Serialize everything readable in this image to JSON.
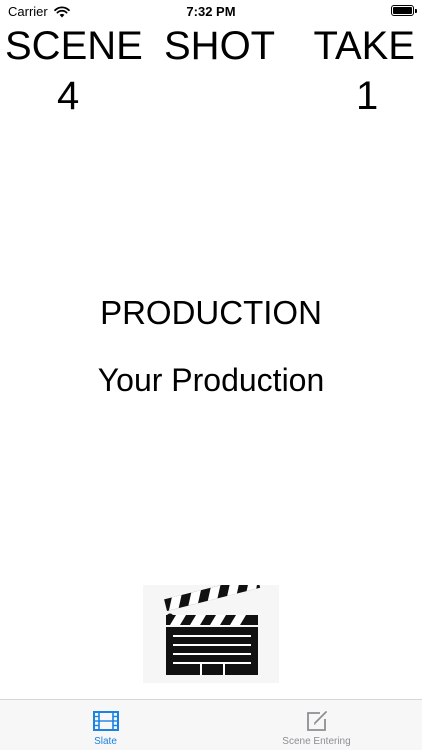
{
  "status_bar": {
    "carrier": "Carrier",
    "time": "7:32 PM"
  },
  "slate": {
    "scene_label": "SCENE",
    "shot_label": "SHOT",
    "take_label": "TAKE",
    "scene_value": "4",
    "take_value": "1",
    "production_label": "PRODUCTION",
    "production_name": "Your Production"
  },
  "tab_bar": {
    "active_color": "#1a82e2",
    "inactive_color": "#8e8e93",
    "tabs": [
      {
        "label": "Slate",
        "icon": "film-icon",
        "active": true
      },
      {
        "label": "Scene Entering",
        "icon": "edit-icon",
        "active": false
      }
    ]
  }
}
